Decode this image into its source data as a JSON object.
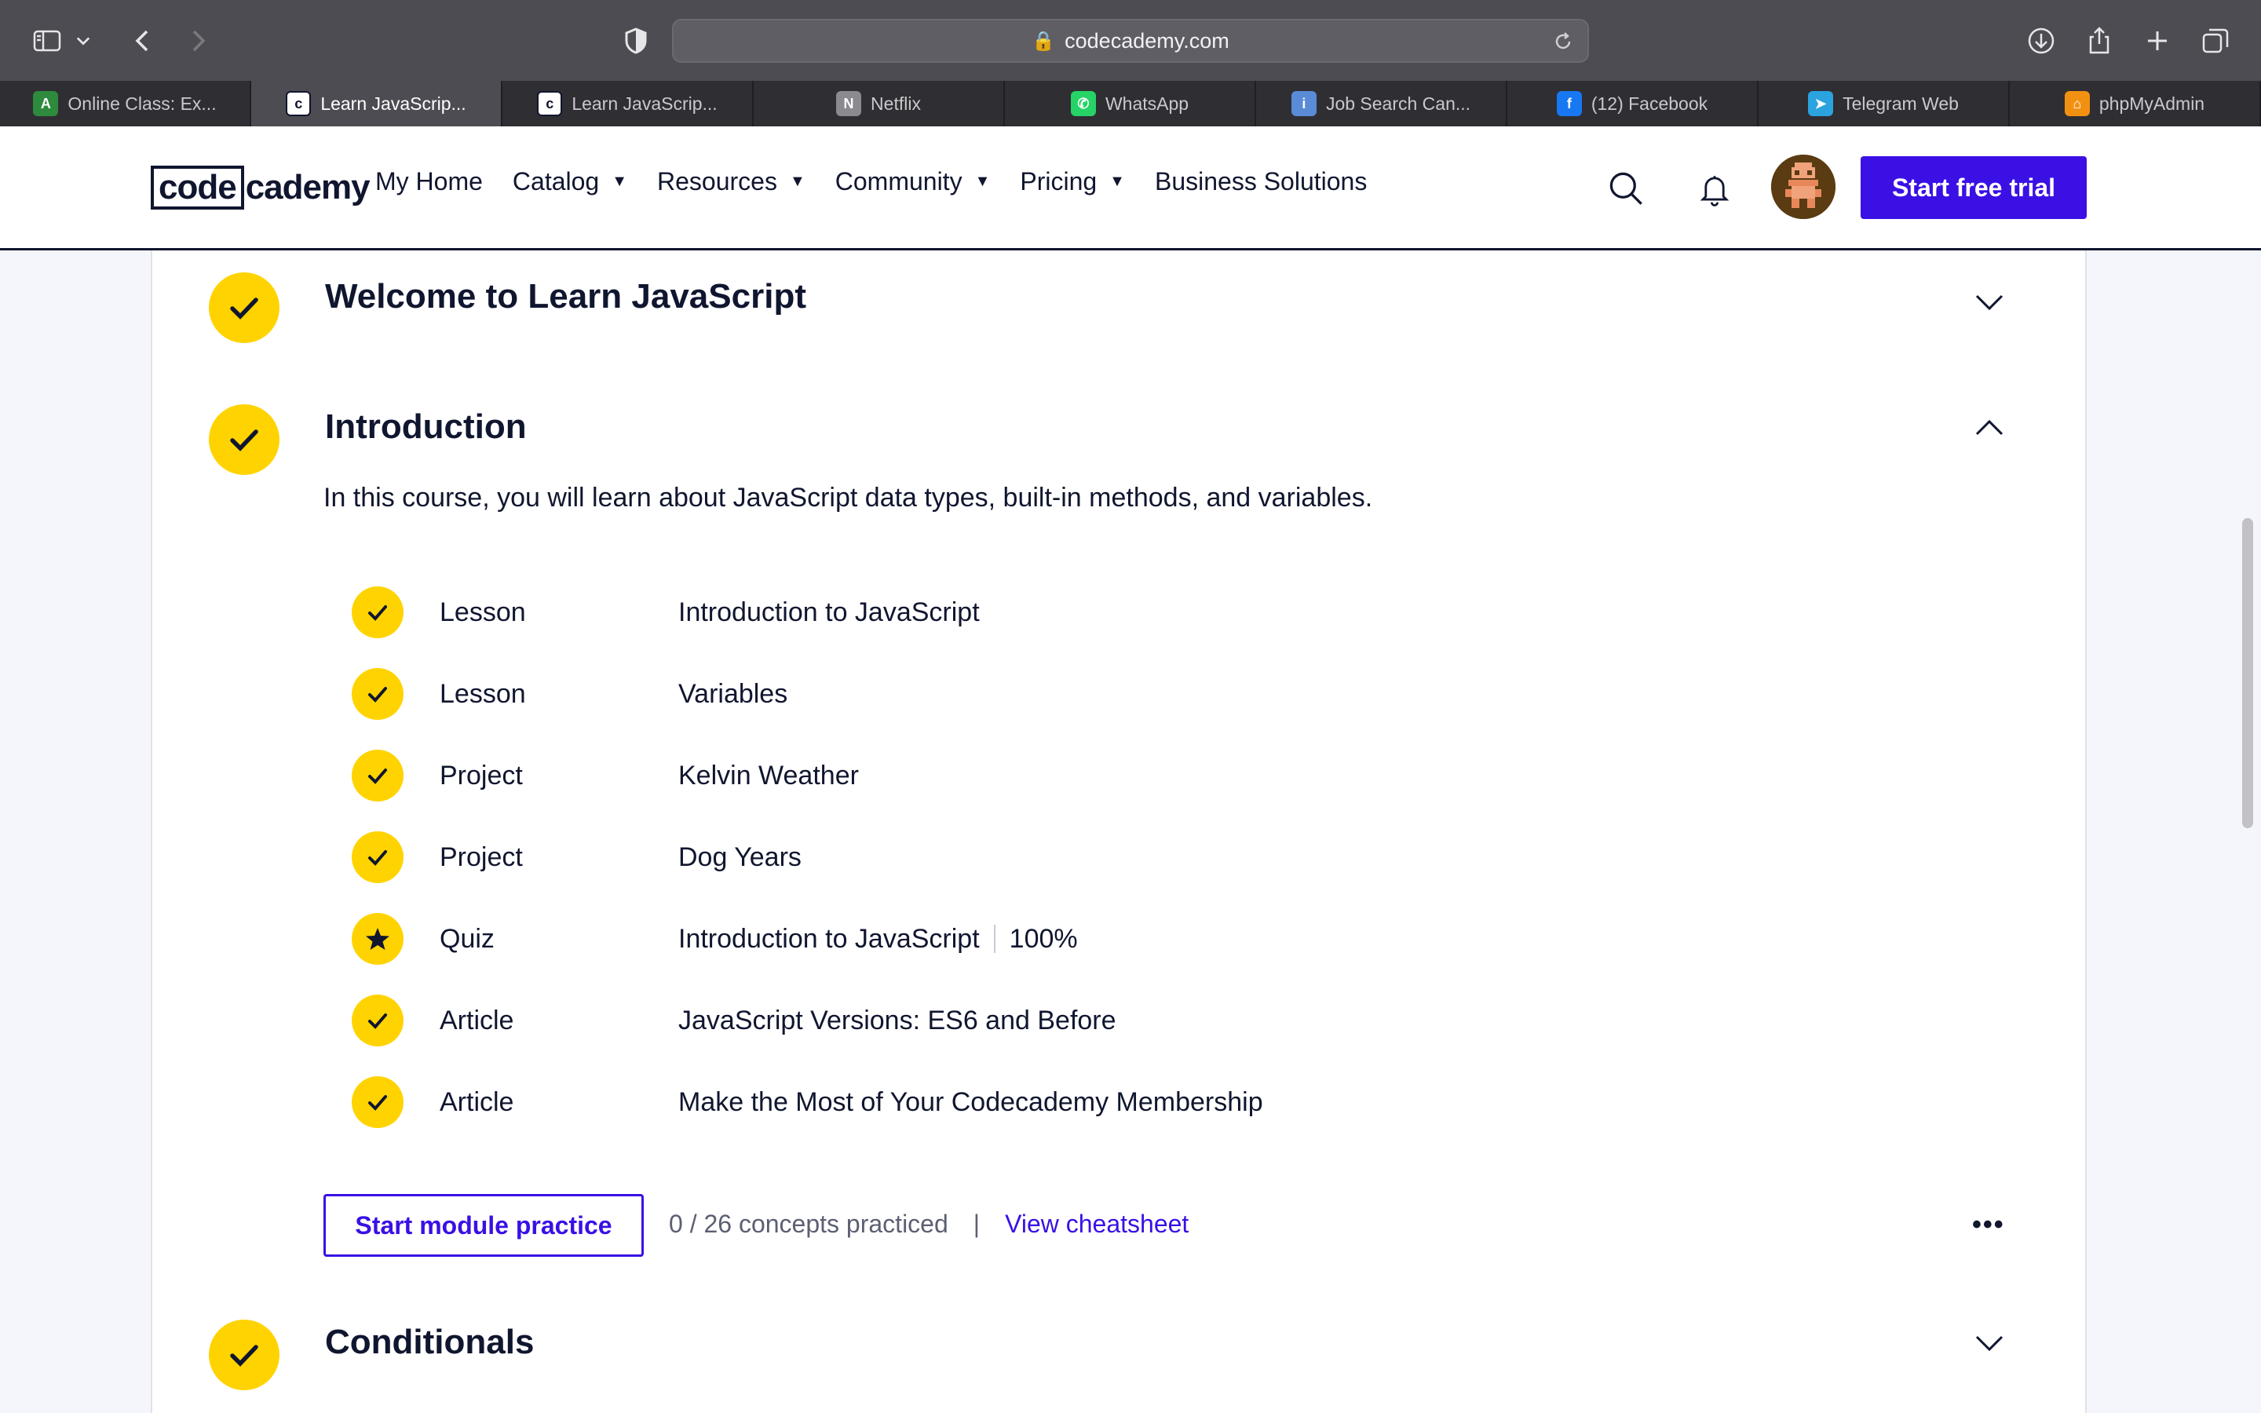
{
  "browser": {
    "url": "codecademy.com",
    "tabs": [
      {
        "label": "Online Class: Ex...",
        "icon": "ac-icon",
        "color": "#2e8b3e"
      },
      {
        "label": "Learn JavaScrip...",
        "icon": "codecademy-icon",
        "color": "#ffffff",
        "active": true
      },
      {
        "label": "Learn JavaScrip...",
        "icon": "codecademy-icon",
        "color": "#ffffff"
      },
      {
        "label": "Netflix",
        "icon": "netflix-icon",
        "color": "#8a8a8f"
      },
      {
        "label": "WhatsApp",
        "icon": "whatsapp-icon",
        "color": "#25d366"
      },
      {
        "label": "Job Search Can...",
        "icon": "info-icon",
        "color": "#5a8bd6"
      },
      {
        "label": "(12) Facebook",
        "icon": "facebook-icon",
        "color": "#1877f2"
      },
      {
        "label": "Telegram Web",
        "icon": "telegram-icon",
        "color": "#2aa3df"
      },
      {
        "label": "phpMyAdmin",
        "icon": "phpmyadmin-icon",
        "color": "#f29111"
      }
    ]
  },
  "header": {
    "logo_boxed": "code",
    "logo_rest": "cademy",
    "nav": [
      {
        "label": "My Home",
        "dropdown": false
      },
      {
        "label": "Catalog",
        "dropdown": true
      },
      {
        "label": "Resources",
        "dropdown": true
      },
      {
        "label": "Community",
        "dropdown": true
      },
      {
        "label": "Pricing",
        "dropdown": true
      },
      {
        "label": "Business Solutions",
        "dropdown": false
      }
    ],
    "cta": "Start free trial",
    "caret": "▼"
  },
  "modules": [
    {
      "title": "Welcome to Learn JavaScript",
      "expanded": false
    },
    {
      "title": "Introduction",
      "expanded": true,
      "description": "In this course, you will learn about JavaScript data types, built-in methods, and variables.",
      "items": [
        {
          "type": "Lesson",
          "name": "Introduction to JavaScript",
          "status": "check-icon"
        },
        {
          "type": "Lesson",
          "name": "Variables",
          "status": "check-icon"
        },
        {
          "type": "Project",
          "name": "Kelvin Weather",
          "status": "check-icon"
        },
        {
          "type": "Project",
          "name": "Dog Years",
          "status": "check-icon"
        },
        {
          "type": "Quiz",
          "name": "Introduction to JavaScript",
          "score": "100%",
          "status": "star-icon"
        },
        {
          "type": "Article",
          "name": "JavaScript Versions: ES6 and Before",
          "status": "check-icon"
        },
        {
          "type": "Article",
          "name": "Make the Most of Your Codecademy Membership",
          "status": "check-icon"
        }
      ],
      "practice_button": "Start module practice",
      "concepts": "0 / 26 concepts practiced",
      "separator": "|",
      "cheatsheet": "View cheatsheet",
      "more": "•••"
    },
    {
      "title": "Conditionals",
      "expanded": false
    }
  ],
  "colors": {
    "accent": "#3a10e5",
    "check": "#ffd300",
    "text": "#10162f"
  }
}
